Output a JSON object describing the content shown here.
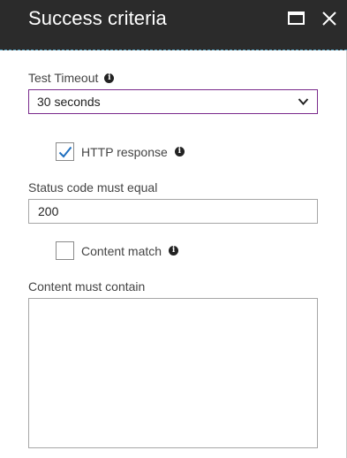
{
  "header": {
    "title": "Success criteria",
    "maximize_icon": "maximize-icon",
    "close_icon": "close-icon"
  },
  "form": {
    "timeout": {
      "label": "Test Timeout",
      "value": "30 seconds",
      "info_icon": "info-icon"
    },
    "http_response": {
      "label": "HTTP response",
      "checked": true,
      "info_icon": "info-icon"
    },
    "status_code": {
      "label": "Status code must equal",
      "value": "200"
    },
    "content_match": {
      "label": "Content match",
      "checked": false,
      "info_icon": "info-icon"
    },
    "content_contains": {
      "label": "Content must contain",
      "value": ""
    }
  },
  "colors": {
    "header_bg": "#2b2b2b",
    "select_border": "#7a2a8c",
    "checkmark": "#1f6fbf"
  }
}
